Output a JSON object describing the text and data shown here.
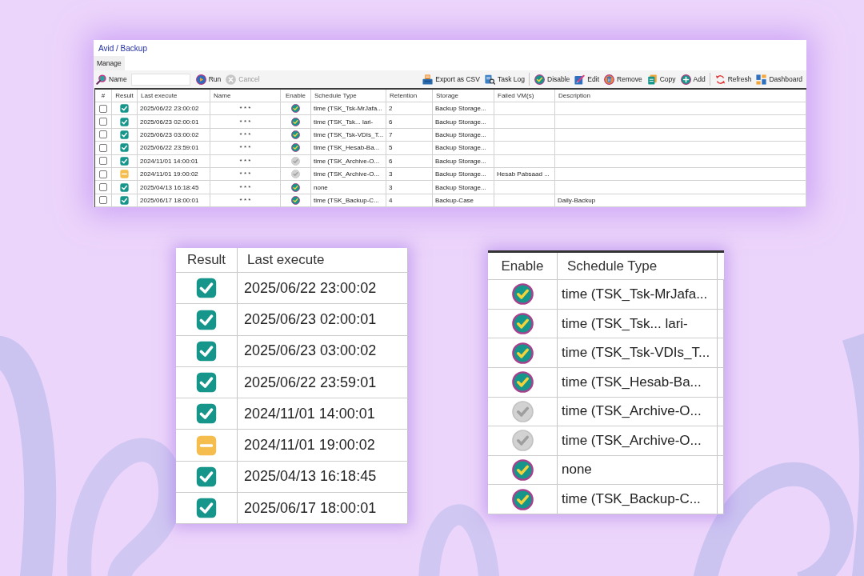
{
  "window": {
    "title": "Avid / Backup"
  },
  "tabs": [
    {
      "label": "Manage",
      "selected": true
    }
  ],
  "toolbar": {
    "search_label": "Name",
    "actions": [
      {
        "label": "Run",
        "disabled": false
      },
      {
        "label": "Cancel",
        "disabled": true
      }
    ],
    "groups": [
      [
        "Export as CSV",
        "Task Log"
      ],
      [
        "Disable",
        "Edit",
        "Remove",
        "Copy",
        "Add"
      ],
      [
        "Refresh",
        "Dashboard"
      ]
    ]
  },
  "table": {
    "columns": [
      "#",
      "Result",
      "Last execute",
      "Name",
      "Enable",
      "Schedule Type",
      "Retention",
      "Storage",
      "Failed VM(s)",
      "Description"
    ],
    "rows": [
      {
        "checked": false,
        "warning": false,
        "last_execute": "2025/06/22 23:00:02",
        "name": "* * *",
        "enabled": true,
        "schedule_type": "time (TSK_Tsk-MrJafa...",
        "retention": "2",
        "storage": "Backup Storage..."
      },
      {
        "checked": false,
        "warning": false,
        "last_execute": "2025/06/23 02:00:01",
        "name": "* * *",
        "enabled": true,
        "schedule_type": "time (TSK_Tsk... lari-",
        "retention": "6",
        "storage": "Backup Storage..."
      },
      {
        "checked": false,
        "warning": false,
        "last_execute": "2025/06/23 03:00:02",
        "name": "* * *",
        "enabled": true,
        "schedule_type": "time (TSK_Tsk-VDIs_T...",
        "retention": "7",
        "storage": "Backup Storage..."
      },
      {
        "checked": false,
        "warning": false,
        "last_execute": "2025/06/22 23:59:01",
        "name": "* * *",
        "enabled": true,
        "schedule_type": "time (TSK_Hesab-Ba...",
        "retention": "5",
        "storage": "Backup Storage..."
      },
      {
        "checked": false,
        "warning": false,
        "last_execute": "2024/11/01 14:00:01",
        "name": "* * *",
        "enabled": false,
        "schedule_type": "time (TSK_Archive-O...",
        "retention": "6",
        "storage": "Backup Storage..."
      },
      {
        "checked": false,
        "warning": true,
        "last_execute": "2024/11/01 19:00:02",
        "name": "* * *",
        "enabled": false,
        "schedule_type": "time (TSK_Archive-O...",
        "retention": "3",
        "storage": "Backup Storage...",
        "failed_vms": "Hesab Pabsaad ..."
      },
      {
        "checked": false,
        "warning": false,
        "last_execute": "2025/04/13 16:18:45",
        "name": "* * *",
        "enabled": true,
        "schedule_type": "none",
        "retention": "3",
        "storage": "Backup Storage..."
      },
      {
        "checked": false,
        "warning": false,
        "last_execute": "2025/06/17 18:00:01",
        "name": "* * *",
        "enabled": true,
        "schedule_type": "time (TSK_Backup-C...",
        "retention": "4",
        "storage": "Backup-Case",
        "description": "Daily-Backup"
      }
    ]
  },
  "result_inset": {
    "columns": [
      "Result",
      "Last execute"
    ],
    "rows": [
      {
        "warning": false,
        "last_execute": "2025/06/22 23:00:02"
      },
      {
        "warning": false,
        "last_execute": "2025/06/23 02:00:01"
      },
      {
        "warning": false,
        "last_execute": "2025/06/23 03:00:02"
      },
      {
        "warning": false,
        "last_execute": "2025/06/22 23:59:01"
      },
      {
        "warning": false,
        "last_execute": "2024/11/01 14:00:01"
      },
      {
        "warning": true,
        "last_execute": "2024/11/01 19:00:02"
      },
      {
        "warning": false,
        "last_execute": "2025/04/13 16:18:45"
      },
      {
        "warning": false,
        "last_execute": "2025/06/17 18:00:01"
      }
    ]
  },
  "schedule_inset": {
    "columns": [
      "Enable",
      "Schedule Type"
    ],
    "rows": [
      {
        "enabled": true,
        "schedule_type": "time (TSK_Tsk-MrJafa..."
      },
      {
        "enabled": true,
        "schedule_type": "time (TSK_Tsk... lari-"
      },
      {
        "enabled": true,
        "schedule_type": "time (TSK_Tsk-VDIs_T..."
      },
      {
        "enabled": true,
        "schedule_type": "time (TSK_Hesab-Ba..."
      },
      {
        "enabled": false,
        "schedule_type": "time (TSK_Archive-O..."
      },
      {
        "enabled": false,
        "schedule_type": "time (TSK_Archive-O..."
      },
      {
        "enabled": true,
        "schedule_type": "none"
      },
      {
        "enabled": true,
        "schedule_type": "time (TSK_Backup-C..."
      }
    ]
  }
}
